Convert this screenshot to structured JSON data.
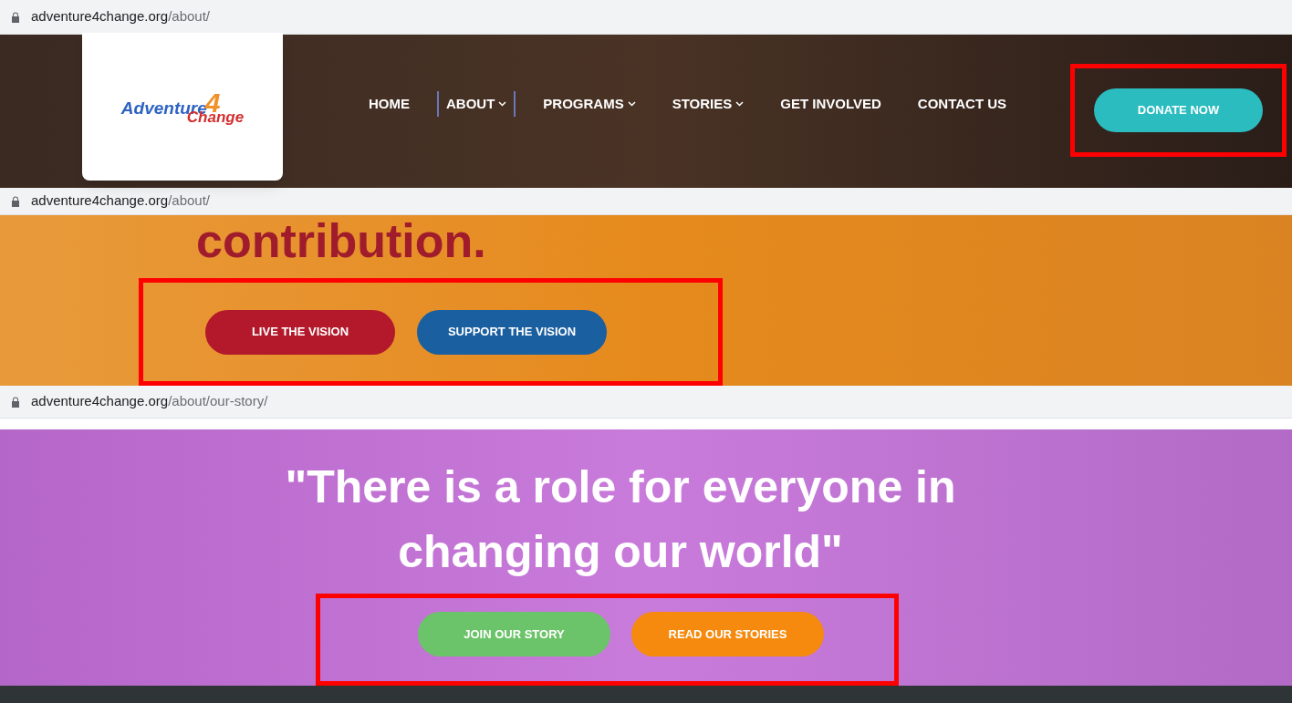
{
  "panels": [
    {
      "url": {
        "domain": "adventure4change.org",
        "path": "/about/"
      },
      "kind": "header",
      "logo": {
        "word1": "Adventure",
        "numeral": "4",
        "word2": "Change"
      },
      "nav": [
        {
          "label": "HOME",
          "has_dropdown": false,
          "selected": false
        },
        {
          "label": "ABOUT",
          "has_dropdown": true,
          "selected": true
        },
        {
          "label": "PROGRAMS",
          "has_dropdown": true,
          "selected": false
        },
        {
          "label": "STORIES",
          "has_dropdown": true,
          "selected": false
        },
        {
          "label": "GET INVOLVED",
          "has_dropdown": false,
          "selected": false
        },
        {
          "label": "CONTACT US",
          "has_dropdown": false,
          "selected": false
        }
      ],
      "cta": {
        "highlighted": true,
        "buttons": [
          {
            "label": "DONATE NOW",
            "color": "#2bbcc0"
          }
        ]
      }
    },
    {
      "url": {
        "domain": "adventure4change.org",
        "path": "/about/"
      },
      "kind": "orange",
      "heading": "contribution.",
      "cta": {
        "highlighted": true,
        "buttons": [
          {
            "label": "LIVE THE VISION",
            "color": "#b3192a"
          },
          {
            "label": "SUPPORT THE VISION",
            "color": "#1a5fa0"
          }
        ]
      }
    },
    {
      "url": {
        "domain": "adventure4change.org",
        "path": "/about/our-story/"
      },
      "kind": "purple",
      "quote": "\"There is a role for everyone in changing our world\"",
      "cta": {
        "highlighted": true,
        "buttons": [
          {
            "label": "JOIN OUR STORY",
            "color": "#6cc46a"
          },
          {
            "label": "READ OUR STORIES",
            "color": "#f58a0e"
          }
        ]
      }
    }
  ]
}
